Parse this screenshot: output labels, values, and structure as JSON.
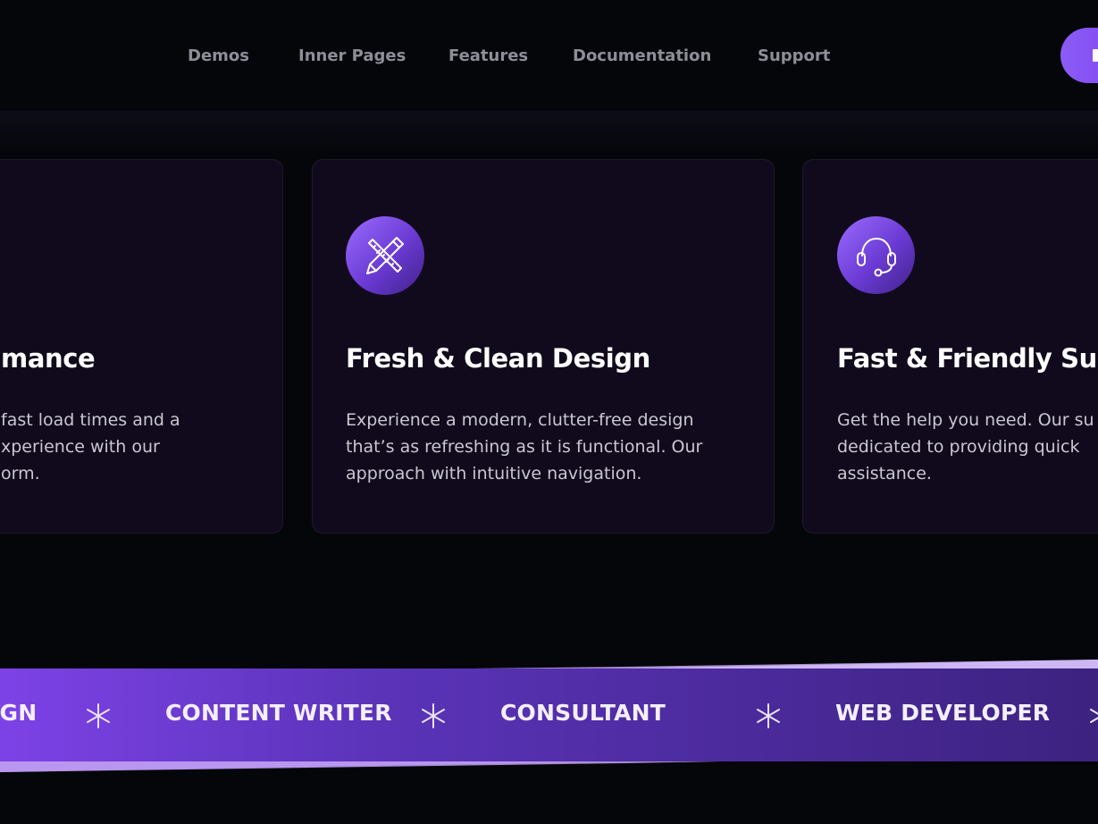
{
  "header": {
    "nav": [
      "Demos",
      "Inner Pages",
      "Features",
      "Documentation",
      "Support"
    ]
  },
  "cards": [
    {
      "title": "mance",
      "text": "fast load times and a\nxperience with our\norm."
    },
    {
      "icon": "pencil-ruler-icon",
      "title": "Fresh & Clean Design",
      "text": "Experience a modern, clutter-free design\nthat’s as refreshing as it is functional. Our\napproach with intuitive navigation."
    },
    {
      "icon": "headset-icon",
      "title": "Fast & Friendly Supp",
      "text": "Get the help you need. Our su\ndedicated to providing quick\nassistance."
    }
  ],
  "ribbon": {
    "items": [
      "IGN",
      "CONTENT WRITER",
      "CONSULTANT",
      "WEB DEVELOPER"
    ]
  },
  "colors": {
    "background": "#050609",
    "card": "#110a1c",
    "accent": "#8b5cf6",
    "nav_text": "#8d8f98"
  }
}
